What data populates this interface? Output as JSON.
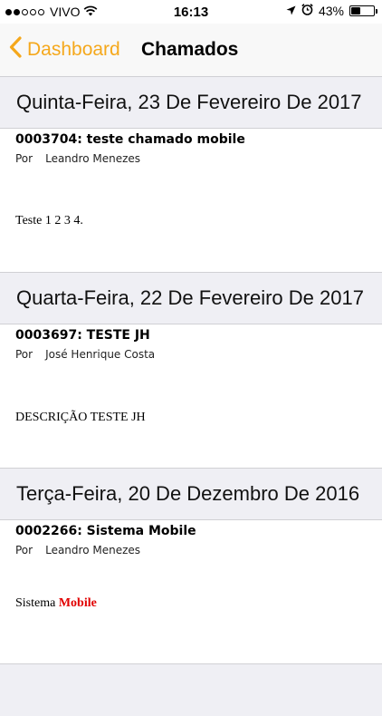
{
  "status": {
    "carrier": "VIVO",
    "time": "16:13",
    "battery": "43%",
    "battery_level": 0.43
  },
  "nav": {
    "back_label": "Dashboard",
    "title": "Chamados"
  },
  "sections": [
    {
      "date": "Quinta-Feira, 23 De Fevereiro De 2017",
      "ticket": {
        "title": "0003704: teste chamado mobile",
        "por": "Por",
        "author": "Leandro Menezes",
        "description": "Teste 1 2 3 4."
      }
    },
    {
      "date": "Quarta-Feira, 22 De Fevereiro De 2017",
      "ticket": {
        "title": "0003697: TESTE JH",
        "por": "Por",
        "author": "José Henrique Costa",
        "description": "DESCRIÇÃO TESTE JH"
      }
    },
    {
      "date": "Terça-Feira, 20 De Dezembro De 2016",
      "ticket": {
        "title": "0002266: Sistema Mobile",
        "por": "Por",
        "author": "Leandro Menezes",
        "description_plain": "Sistema",
        "description_highlight": "Mobile",
        "highlight_color": "#e10000"
      }
    }
  ]
}
